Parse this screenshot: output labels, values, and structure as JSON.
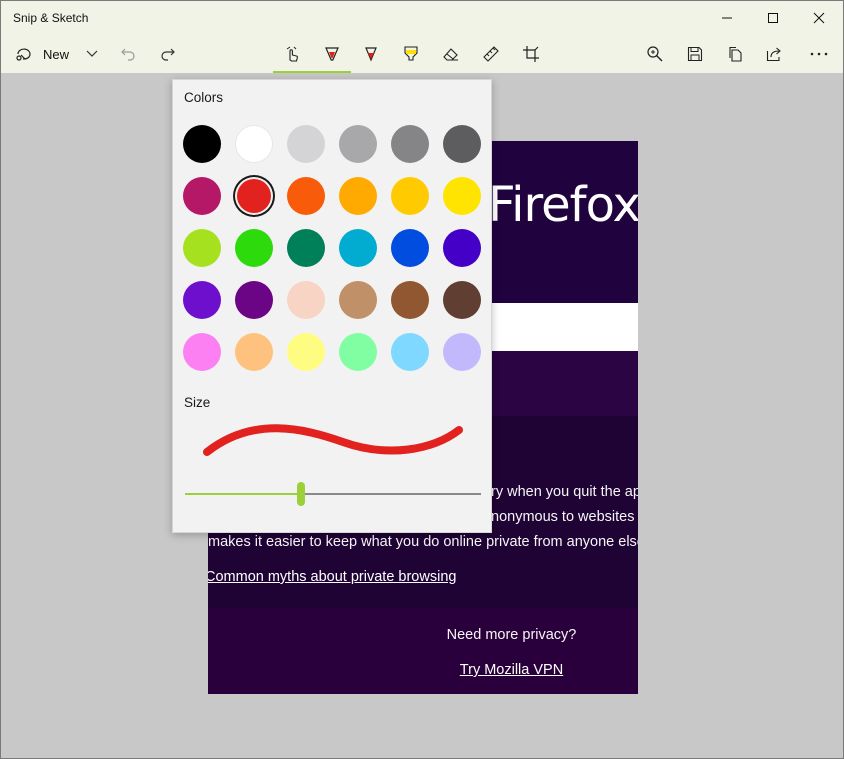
{
  "window": {
    "title": "Snip & Sketch"
  },
  "toolbar": {
    "new_label": "New",
    "tools": [
      {
        "name": "touch-writing",
        "icon": "touch-writing-icon"
      },
      {
        "name": "ballpoint-pen",
        "icon": "ballpoint-pen-icon",
        "color": "#e0201c"
      },
      {
        "name": "pencil",
        "icon": "pencil-icon",
        "color": "#e0201c"
      },
      {
        "name": "highlighter",
        "icon": "highlighter-icon",
        "color": "#ffe000"
      },
      {
        "name": "eraser",
        "icon": "eraser-icon"
      },
      {
        "name": "ruler",
        "icon": "ruler-icon"
      },
      {
        "name": "crop",
        "icon": "crop-icon"
      }
    ],
    "actions": [
      "zoom-icon",
      "save-icon",
      "copy-icon",
      "share-icon",
      "more-icon"
    ],
    "accent": "#9bd03b"
  },
  "flyout": {
    "colors_heading": "Colors",
    "size_heading": "Size",
    "selected_color_index": 7,
    "colors": [
      "#000000",
      "#ffffff",
      "#d4d4d6",
      "#a8a8aa",
      "#858587",
      "#5d5d5f",
      "#b51866",
      "#e1221f",
      "#f85c0b",
      "#ffaa01",
      "#ffcb00",
      "#ffe402",
      "#a5e11f",
      "#2ddb0c",
      "#008059",
      "#01acd0",
      "#004de0",
      "#4500c8",
      "#6e0fce",
      "#6c0585",
      "#f7d4c4",
      "#c09068",
      "#915731",
      "#603e32",
      "#fd80f2",
      "#ffc27e",
      "#fffd81",
      "#81fea2",
      "#7ed8ff",
      "#c2b9fd"
    ],
    "size_value_fraction": 0.4
  },
  "canvas": {
    "brand": "Firefox",
    "info_lines": [
      "ry when you quit the ap",
      "nonymous to websites o",
      "makes it easier to keep what you do online private from anyone else"
    ],
    "myths_link": "Common myths about private browsing",
    "need_privacy": "Need more privacy?",
    "vpn_link": "Try Mozilla VPN"
  }
}
